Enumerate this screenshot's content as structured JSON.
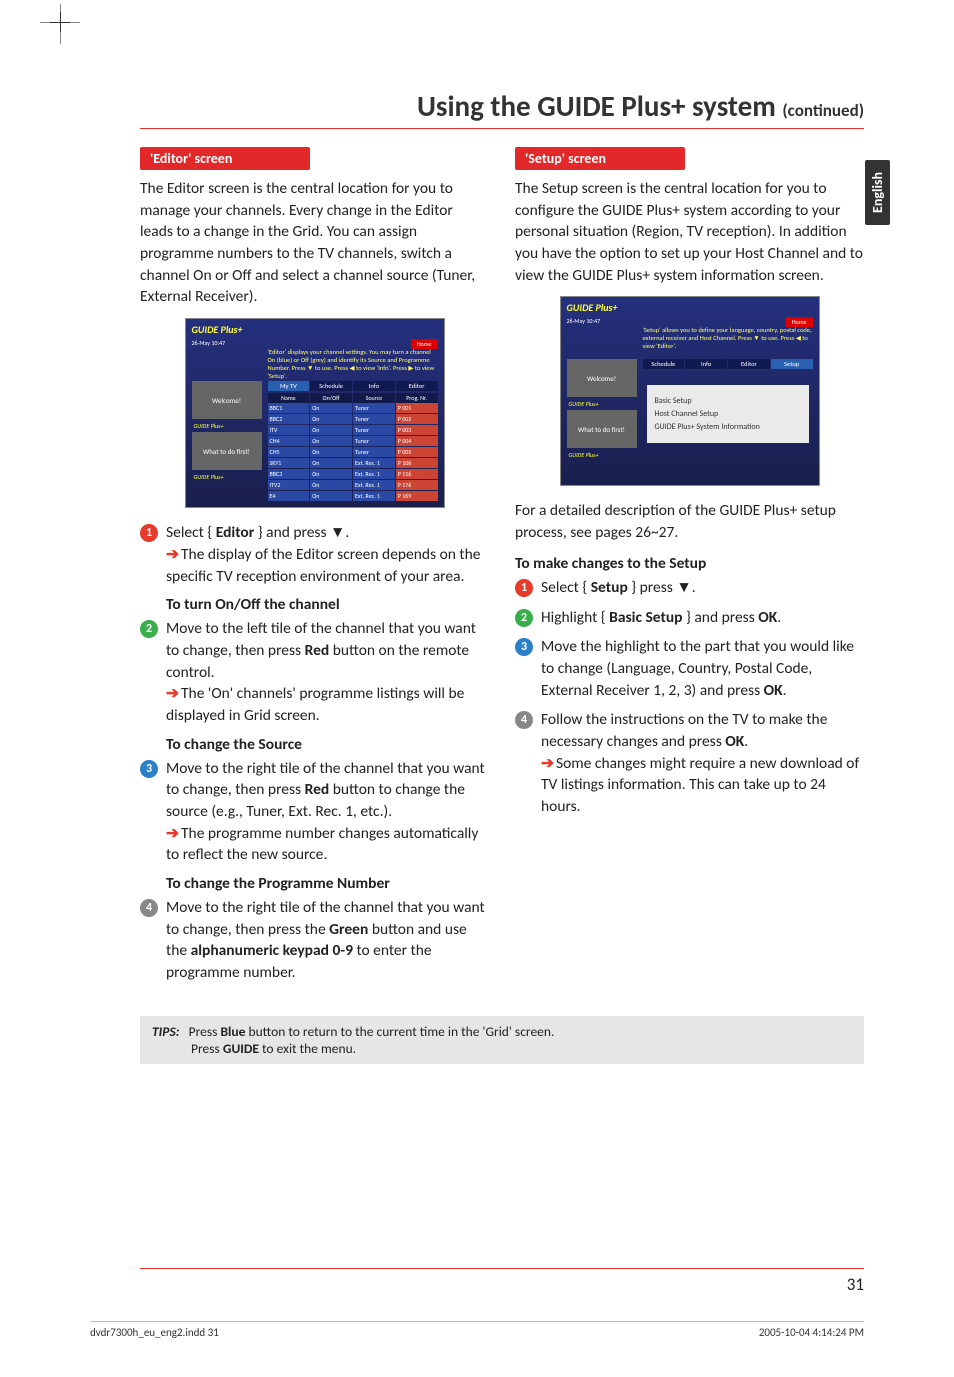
{
  "title_main": "Using the GUIDE Plus+ system ",
  "title_cont": "(continued)",
  "lang_tab": "English",
  "editor": {
    "header": "'Editor' screen",
    "intro": "The Editor screen is the central location for you to manage your channels. Every change in the Editor leads to a change in the Grid. You can assign programme numbers to the TV channels, switch a channel On or Off and select a channel source (Tuner, External Receiver).",
    "scr_logo": "GUIDE Plus+",
    "scr_date": "26-May   10:47",
    "scr_home": "Home",
    "scr_info": "'Editor' displays your channel settings. You may turn a channel On (blue) or Off (grey) and identify its Source and Programme Number. Press ▼ to use. Press ◀ to view 'Info'. Press ▶ to view 'Setup'.",
    "scr_tabs": [
      "My TV",
      "Schedule",
      "Info",
      "Editor"
    ],
    "scr_thead": [
      "Name",
      "On/Off",
      "Source",
      "Prog. Nr."
    ],
    "scr_side_welcome": "Welcome!",
    "scr_side_what": "What to do first!",
    "scr_rows": [
      [
        "BBC1",
        "On",
        "Tuner",
        "P 001"
      ],
      [
        "BBC2",
        "On",
        "Tuner",
        "P 002"
      ],
      [
        "ITV",
        "On",
        "Tuner",
        "P 003"
      ],
      [
        "CH4",
        "On",
        "Tuner",
        "P 004"
      ],
      [
        "CH5",
        "On",
        "Tuner",
        "P 005"
      ],
      [
        "SKY1",
        "On",
        "Ext. Rec. 1",
        "P 106"
      ],
      [
        "BBC3",
        "On",
        "Ext. Rec. 1",
        "P 116"
      ],
      [
        "ITV2",
        "On",
        "Ext. Rec. 1",
        "P 176"
      ],
      [
        "E4",
        "On",
        "Ext. Rec. 1",
        "P 169"
      ]
    ],
    "step1_a": "Select { ",
    "step1_b": "Editor",
    "step1_c": " } and press ▼.",
    "step1_res": "The display of the Editor screen depends on the specific TV reception environment of your area.",
    "sub_onoff": "To turn On/Off the channel",
    "step2_a": "Move to the left tile of the channel that you want to change, then press ",
    "step2_b": "Red",
    "step2_c": " button on the remote control.",
    "step2_res": "The 'On' channels' programme listings will be displayed in Grid screen.",
    "sub_src": "To change the Source",
    "step3_a": "Move to the right tile of the channel that you want to change, then press ",
    "step3_b": "Red",
    "step3_c": " button to change the source (e.g., Tuner, Ext. Rec. 1, etc.).",
    "step3_res": "The programme number changes automatically to reflect the new source.",
    "sub_pn": "To change the Programme Number",
    "step4_a": "Move to the right tile of the channel that you want to change, then press the ",
    "step4_b": "Green",
    "step4_c": " button and use the ",
    "step4_d": "alphanumeric keypad 0-9",
    "step4_e": " to enter the programme number."
  },
  "setup": {
    "header": "'Setup' screen",
    "intro": "The Setup screen is the central location for you to configure the GUIDE Plus+ system according to your personal situation (Region, TV reception). In addition you have the option to set up your Host Channel and to view the GUIDE Plus+ system information screen.",
    "scr_info": "'Setup' allows you to define your language, country, postal code, external receiver and Host Channel. Press ▼ to use. Press ◀ to view 'Editor'.",
    "scr_tabs": [
      "Schedule",
      "Info",
      "Editor",
      "Setup"
    ],
    "scr_opts": [
      "Basic Setup",
      "Host Channel Setup",
      "GUIDE Plus+ System Information"
    ],
    "detail": "For a detailed description of the GUIDE Plus+ setup process, see pages 26~27.",
    "sub_changes": "To make changes to the Setup",
    "step1_a": "Select { ",
    "step1_b": "Setup",
    "step1_c": " } press ▼.",
    "step2_a": "Highlight { ",
    "step2_b": "Basic Setup",
    "step2_c": " } and press ",
    "step2_d": "OK",
    "step2_e": ".",
    "step3_a": "Move the highlight to the part that you would like to change (Language, Country, Postal Code, External Receiver 1, 2, 3) and press ",
    "step3_b": "OK",
    "step3_c": ".",
    "step4_a": "Follow the instructions on the TV to make the necessary changes and press ",
    "step4_b": "OK",
    "step4_c": ".",
    "step4_res": "Some changes might require a new download of TV listings information. This can take up to 24 hours."
  },
  "tips": {
    "label": "TIPS:",
    "line1a": "Press ",
    "line1b": "Blue",
    "line1c": " button to return to the current time in the 'Grid' screen.",
    "line2a": "Press ",
    "line2b": "GUIDE",
    "line2c": " to exit the menu."
  },
  "page_number": "31",
  "footer_left": "dvdr7300h_eu_eng2.indd   31",
  "footer_right": "2005-10-04   4:14:24 PM"
}
